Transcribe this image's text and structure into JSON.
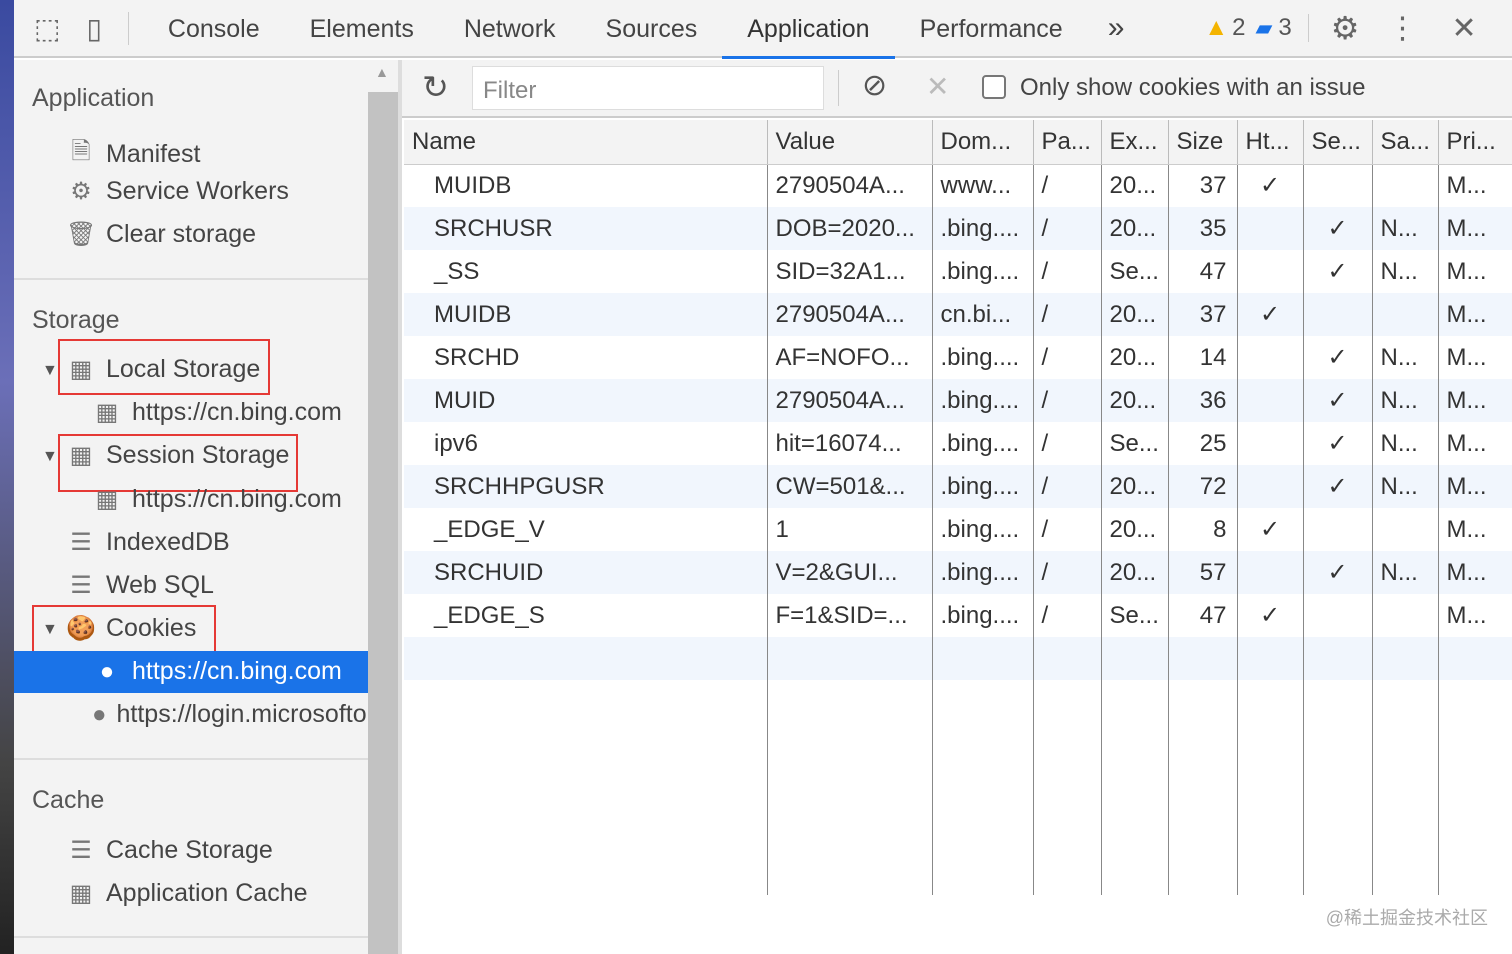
{
  "tabs": [
    "Console",
    "Elements",
    "Network",
    "Sources",
    "Application",
    "Performance"
  ],
  "active_tab": "Application",
  "warnings": "2",
  "messages": "3",
  "sidebar": {
    "application": "Application",
    "app_items": [
      "Manifest",
      "Service Workers",
      "Clear storage"
    ],
    "storage": "Storage",
    "local_storage": "Local Storage",
    "local_child": "https://cn.bing.com",
    "session_storage": "Session Storage",
    "session_child": "https://cn.bing.com",
    "indexeddb": "IndexedDB",
    "websql": "Web SQL",
    "cookies": "Cookies",
    "cookie_children": [
      "https://cn.bing.com",
      "https://login.microsoftonline.com"
    ],
    "cache": "Cache",
    "cache_items": [
      "Cache Storage",
      "Application Cache"
    ]
  },
  "toolbar": {
    "filter_placeholder": "Filter",
    "issue_label": "Only show cookies with an issue"
  },
  "table": {
    "columns": [
      "Name",
      "Value",
      "Dom...",
      "Pa...",
      "Ex...",
      "Size",
      "Ht...",
      "Se...",
      "Sa...",
      "Pri..."
    ],
    "rows": [
      [
        "MUIDB",
        "2790504A...",
        "www...",
        "/",
        "20...",
        "37",
        "✓",
        "",
        "",
        "M..."
      ],
      [
        "SRCHUSR",
        "DOB=2020...",
        ".bing....",
        "/",
        "20...",
        "35",
        "",
        "✓",
        "N...",
        "M..."
      ],
      [
        "_SS",
        "SID=32A1...",
        ".bing....",
        "/",
        "Se...",
        "47",
        "",
        "✓",
        "N...",
        "M..."
      ],
      [
        "MUIDB",
        "2790504A...",
        "cn.bi...",
        "/",
        "20...",
        "37",
        "✓",
        "",
        "",
        "M..."
      ],
      [
        "SRCHD",
        "AF=NOFO...",
        ".bing....",
        "/",
        "20...",
        "14",
        "",
        "✓",
        "N...",
        "M..."
      ],
      [
        "MUID",
        "2790504A...",
        ".bing....",
        "/",
        "20...",
        "36",
        "",
        "✓",
        "N...",
        "M..."
      ],
      [
        "ipv6",
        "hit=16074...",
        ".bing....",
        "/",
        "Se...",
        "25",
        "",
        "✓",
        "N...",
        "M..."
      ],
      [
        "SRCHHPGUSR",
        "CW=501&...",
        ".bing....",
        "/",
        "20...",
        "72",
        "",
        "✓",
        "N...",
        "M..."
      ],
      [
        "_EDGE_V",
        "1",
        ".bing....",
        "/",
        "20...",
        "8",
        "✓",
        "",
        "",
        "M..."
      ],
      [
        "SRCHUID",
        "V=2&GUI...",
        ".bing....",
        "/",
        "20...",
        "57",
        "",
        "✓",
        "N...",
        "M..."
      ],
      [
        "_EDGE_S",
        "F=1&SID=...",
        ".bing....",
        "/",
        "Se...",
        "47",
        "✓",
        "",
        "",
        "M..."
      ]
    ]
  },
  "watermark": "@稀土掘金技术社区"
}
